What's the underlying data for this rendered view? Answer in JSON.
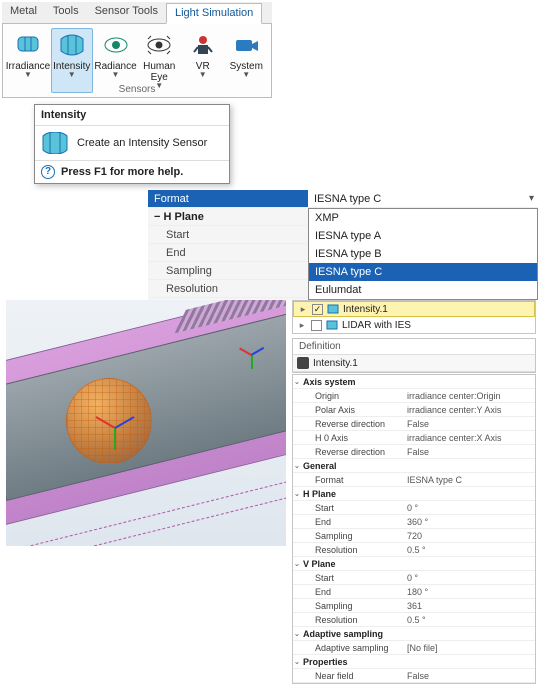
{
  "ribbon": {
    "tabs": [
      "Metal",
      "Tools",
      "Sensor Tools",
      "Light Simulation"
    ],
    "active_tab_index": 3,
    "group_label": "Sensors",
    "sensors": [
      {
        "label": "Irradiance",
        "has_dropdown": true
      },
      {
        "label": "Intensity",
        "has_dropdown": true
      },
      {
        "label": "Radiance",
        "has_dropdown": true
      },
      {
        "label": "Human\nEye",
        "has_dropdown": true
      },
      {
        "label": "VR",
        "has_dropdown": true
      },
      {
        "label": "System",
        "has_dropdown": true
      }
    ],
    "selected_sensor_index": 1
  },
  "tooltip": {
    "title": "Intensity",
    "body": "Create an Intensity Sensor",
    "help": "Press F1 for more help."
  },
  "format_panel": {
    "left": [
      {
        "label": "Format",
        "kind": "selected"
      },
      {
        "label": "H Plane",
        "kind": "header"
      },
      {
        "label": "Start",
        "kind": "row"
      },
      {
        "label": "End",
        "kind": "row"
      },
      {
        "label": "Sampling",
        "kind": "row"
      },
      {
        "label": "Resolution",
        "kind": "row"
      }
    ],
    "combo_value": "IESNA type C",
    "options": [
      "XMP",
      "IESNA type A",
      "IESNA type B",
      "IESNA type C",
      "Eulumdat"
    ],
    "selected_option_index": 3
  },
  "tree": {
    "items": [
      {
        "checked": true,
        "label": "Intensity.1",
        "selected": true
      },
      {
        "checked": false,
        "label": "LIDAR with IES",
        "selected": false
      }
    ]
  },
  "definition": {
    "section_label": "Definition",
    "name": "Intensity.1"
  },
  "properties": [
    {
      "type": "section",
      "label": "Axis system",
      "value": ""
    },
    {
      "type": "row",
      "label": "Origin",
      "value": "irradiance center:Origin"
    },
    {
      "type": "row",
      "label": "Polar Axis",
      "value": "irradiance center:Y Axis"
    },
    {
      "type": "row",
      "label": "Reverse direction",
      "value": "False"
    },
    {
      "type": "row",
      "label": "H 0 Axis",
      "value": "irradiance center:X Axis"
    },
    {
      "type": "row",
      "label": "Reverse direction",
      "value": "False"
    },
    {
      "type": "section",
      "label": "General",
      "value": ""
    },
    {
      "type": "row",
      "label": "Format",
      "value": "IESNA type C"
    },
    {
      "type": "section",
      "label": "H Plane",
      "value": ""
    },
    {
      "type": "row",
      "label": "Start",
      "value": "0 °"
    },
    {
      "type": "row",
      "label": "End",
      "value": "360 °"
    },
    {
      "type": "row",
      "label": "Sampling",
      "value": "720"
    },
    {
      "type": "row",
      "label": "Resolution",
      "value": "0.5 °"
    },
    {
      "type": "section",
      "label": "V Plane",
      "value": ""
    },
    {
      "type": "row",
      "label": "Start",
      "value": "0 °"
    },
    {
      "type": "row",
      "label": "End",
      "value": "180 °"
    },
    {
      "type": "row",
      "label": "Sampling",
      "value": "361"
    },
    {
      "type": "row",
      "label": "Resolution",
      "value": "0.5 °"
    },
    {
      "type": "section",
      "label": "Adaptive sampling",
      "value": ""
    },
    {
      "type": "row",
      "label": "Adaptive sampling",
      "value": "[No file]"
    },
    {
      "type": "section",
      "label": "Properties",
      "value": ""
    },
    {
      "type": "row",
      "label": "Near field",
      "value": "False"
    }
  ],
  "colors": {
    "accent": "#1b62b5",
    "hover": "#cfe6f7"
  }
}
